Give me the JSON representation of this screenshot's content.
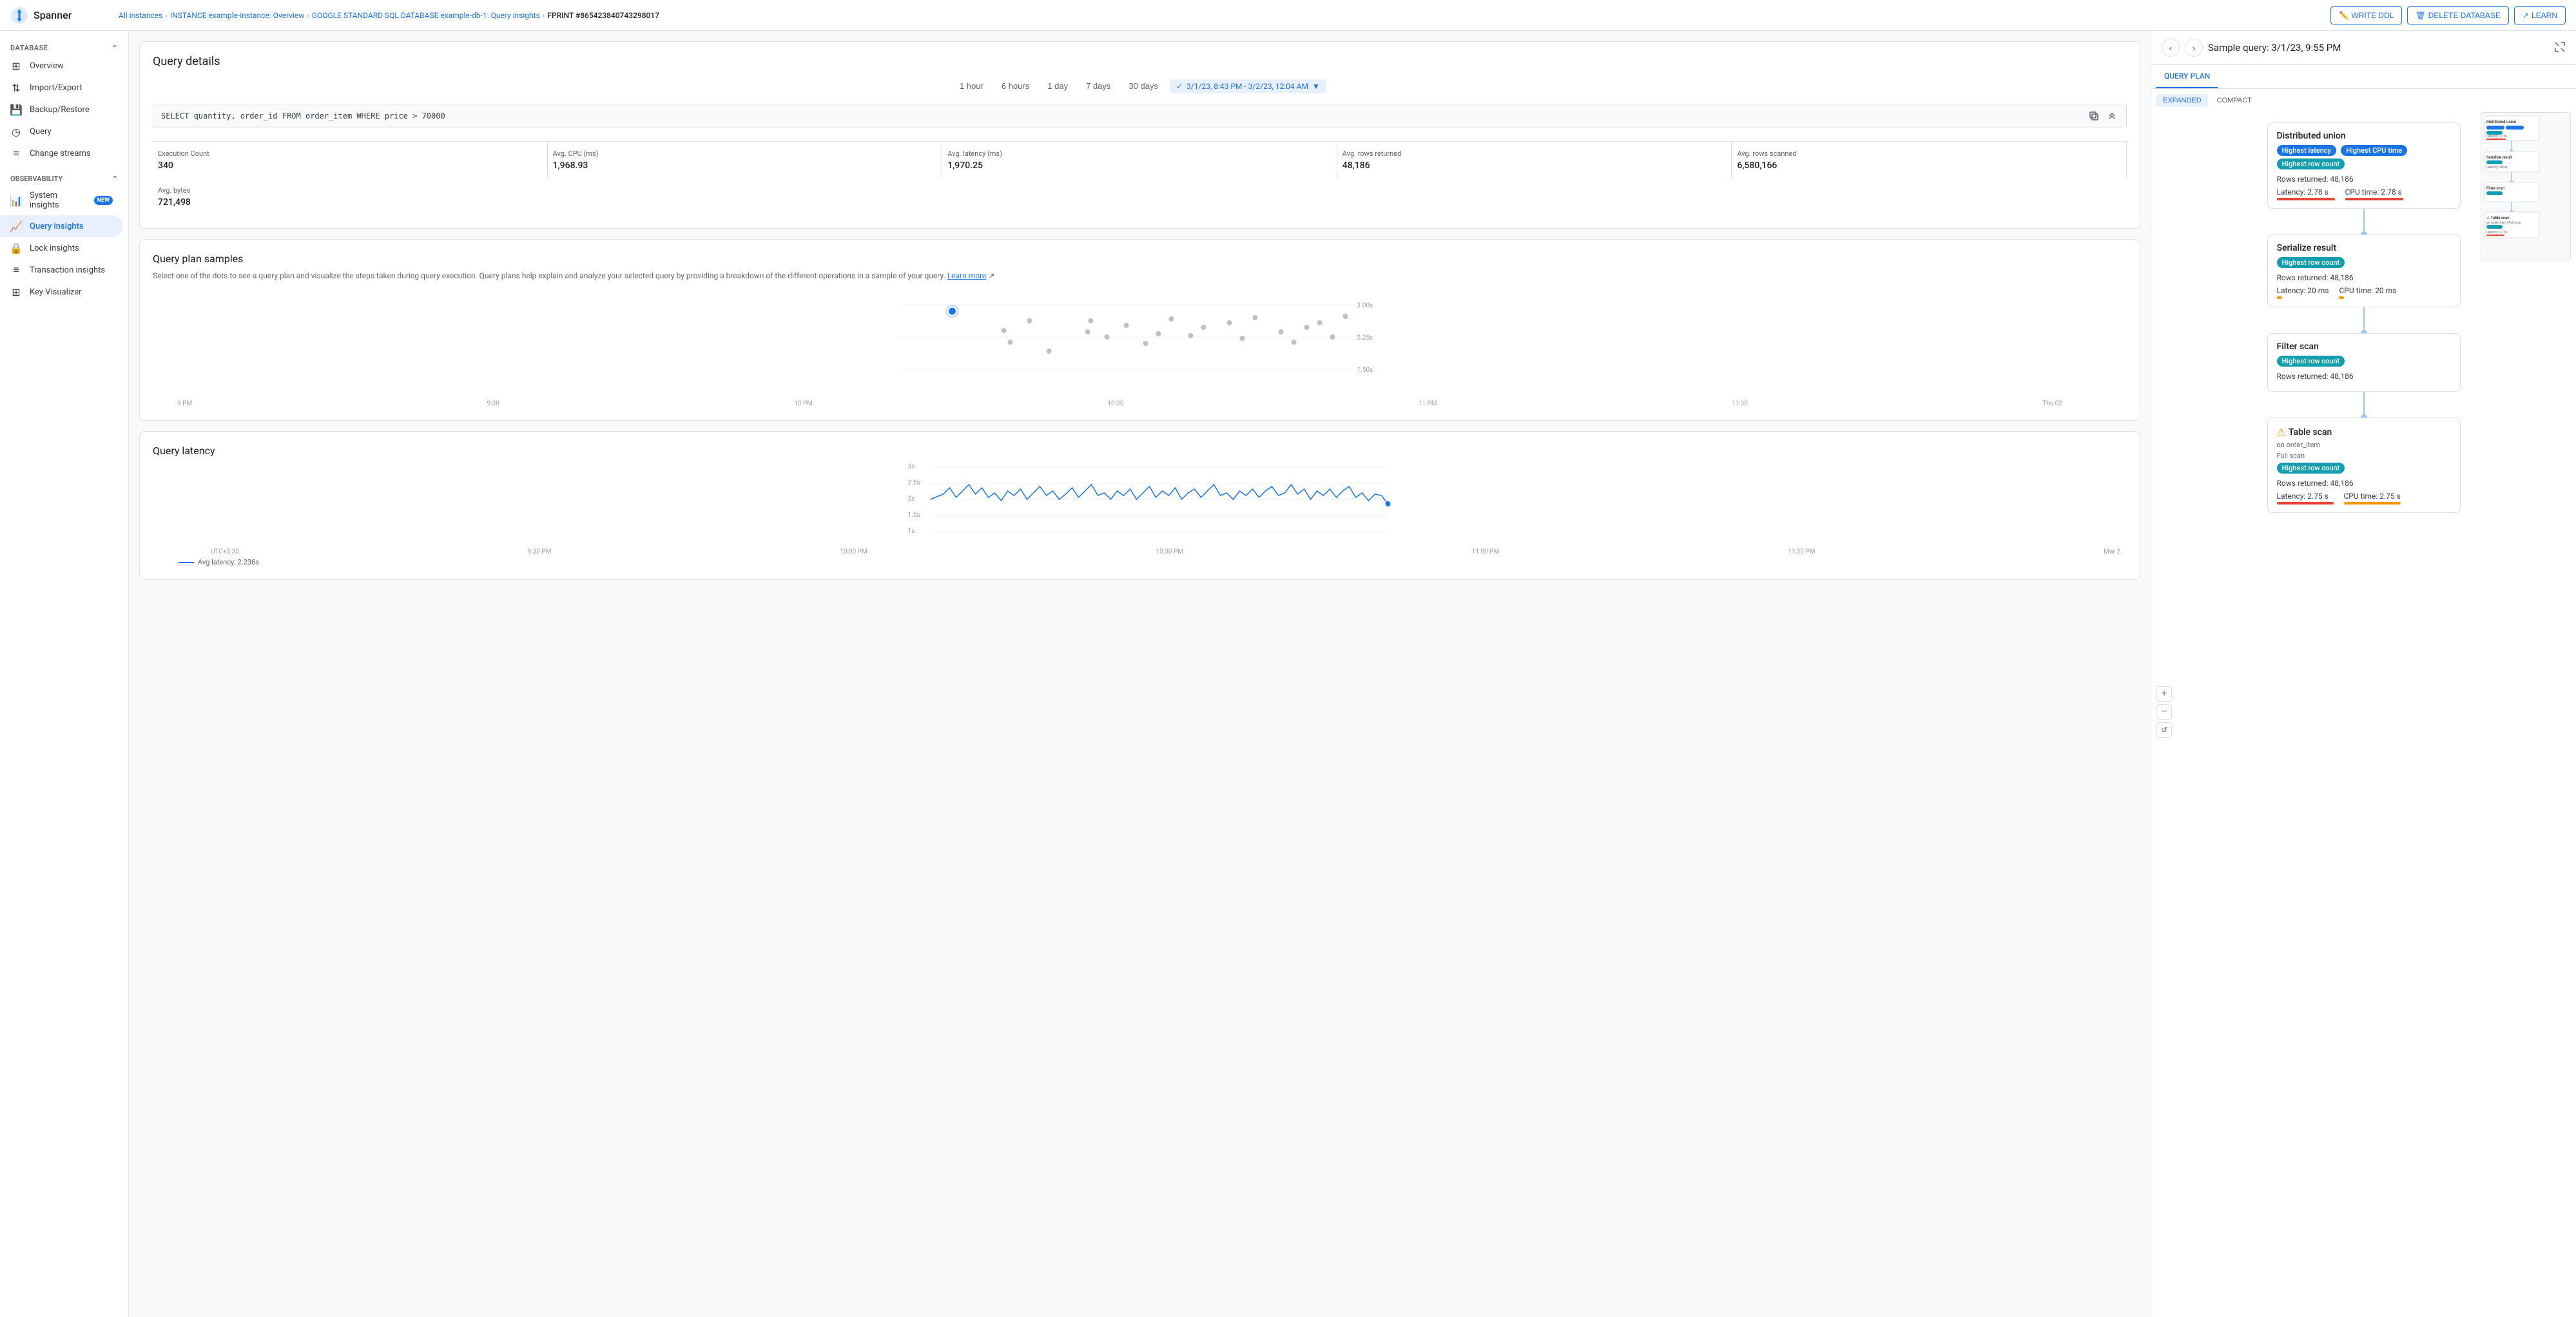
{
  "app": {
    "name": "Spanner"
  },
  "topnav": {
    "breadcrumbs": [
      {
        "label": "All instances",
        "href": "#"
      },
      {
        "label": "INSTANCE example-instance: Overview",
        "href": "#"
      },
      {
        "label": "GOOGLE STANDARD SQL DATABASE example-db-1: Query insights",
        "href": "#"
      },
      {
        "label": "FPRINT #865423840743298017",
        "href": "#",
        "current": true
      }
    ],
    "actions": [
      {
        "label": "WRITE DDL",
        "icon": "✏️"
      },
      {
        "label": "DELETE DATABASE",
        "icon": "🗑"
      },
      {
        "label": "LEARN",
        "icon": "↗"
      }
    ]
  },
  "sidebar": {
    "database_section": "DATABASE",
    "db_items": [
      {
        "id": "overview",
        "label": "Overview",
        "icon": "⊞"
      },
      {
        "id": "import-export",
        "label": "Import/Export",
        "icon": "⇅"
      },
      {
        "id": "backup-restore",
        "label": "Backup/Restore",
        "icon": "💾"
      },
      {
        "id": "query",
        "label": "Query",
        "icon": "◷"
      }
    ],
    "change_streams": {
      "label": "Change streams",
      "icon": "≡"
    },
    "observability_section": "OBSERVABILITY",
    "obs_items": [
      {
        "id": "system-insights",
        "label": "System insights",
        "icon": "📊",
        "badge": "NEW"
      },
      {
        "id": "query-insights",
        "label": "Query insights",
        "icon": "📈",
        "active": true
      },
      {
        "id": "lock-insights",
        "label": "Lock insights",
        "icon": "🔒"
      },
      {
        "id": "transaction-insights",
        "label": "Transaction insights",
        "icon": "≡"
      },
      {
        "id": "key-visualizer",
        "label": "Key Visualizer",
        "icon": "⊞"
      }
    ]
  },
  "query_details": {
    "title": "Query details",
    "time_buttons": [
      "1 hour",
      "6 hours",
      "1 day",
      "7 days",
      "30 days"
    ],
    "selected_range": "3/1/23, 8:43 PM - 3/2/23, 12:04 AM",
    "sql": "SELECT quantity, order_id FROM order_item WHERE price > 70000",
    "stats": [
      {
        "label": "Execution Count",
        "value": "340"
      },
      {
        "label": "Avg. CPU (ms)",
        "value": "1,968.93"
      },
      {
        "label": "Avg. latency (ms)",
        "value": "1,970.25"
      },
      {
        "label": "Avg. rows returned",
        "value": "48,186"
      },
      {
        "label": "Avg. rows scanned",
        "value": "6,580,166"
      },
      {
        "label": "Avg. bytes",
        "value": "721,498"
      }
    ]
  },
  "query_plan_samples": {
    "title": "Query plan samples",
    "description": "Select one of the dots to see a query plan and visualize the steps taken during query execution. Query plans help explain and analyze your selected query by providing a breakdown of the different operations in a sample of your query.",
    "learn_more": "Learn more",
    "x_labels": [
      "9 PM",
      "9:30",
      "10 PM",
      "10:30",
      "11 PM",
      "11:30",
      "Thu 02"
    ],
    "y_labels": [
      "3.00s",
      "2.25s",
      "1.50s"
    ],
    "dots": [
      {
        "x": 15,
        "y": 18,
        "selected": true
      },
      {
        "x": 25,
        "y": 38
      },
      {
        "x": 32,
        "y": 28
      },
      {
        "x": 45,
        "y": 62
      },
      {
        "x": 50,
        "y": 42
      },
      {
        "x": 55,
        "y": 55
      },
      {
        "x": 60,
        "y": 35
      },
      {
        "x": 65,
        "y": 48
      },
      {
        "x": 70,
        "y": 30
      },
      {
        "x": 72,
        "y": 45
      },
      {
        "x": 75,
        "y": 28
      },
      {
        "x": 78,
        "y": 55
      },
      {
        "x": 82,
        "y": 25
      },
      {
        "x": 85,
        "y": 42
      },
      {
        "x": 87,
        "y": 30
      },
      {
        "x": 90,
        "y": 48
      },
      {
        "x": 92,
        "y": 58
      },
      {
        "x": 95,
        "y": 32
      }
    ]
  },
  "query_latency": {
    "title": "Query latency",
    "y_labels": [
      "3s",
      "2.5s",
      "2s",
      "1.5s",
      "1s"
    ],
    "x_labels": [
      "UTC+5:30",
      "9:30 PM",
      "10:00 PM",
      "10:30 PM",
      "11:00 PM",
      "11:30 PM",
      "Mar 2"
    ],
    "legend": "Avg latency: 2.236s"
  },
  "right_panel": {
    "title": "Sample query: 3/1/23, 9:55 PM",
    "tabs": [
      "QUERY PLAN"
    ],
    "view_modes": [
      "EXPANDED",
      "COMPACT"
    ],
    "nodes": [
      {
        "id": "distributed-union",
        "title": "Distributed union",
        "badges": [
          {
            "label": "Highest latency",
            "type": "blue"
          },
          {
            "label": "Highest CPU time",
            "type": "blue"
          },
          {
            "label": "Highest row count",
            "type": "teal"
          }
        ],
        "rows_returned": "Rows returned: 48,186",
        "latency_label": "Latency: 2.78 s",
        "cpu_label": "CPU time: 2.78 s",
        "latency_bar_width": 90,
        "cpu_bar_width": 90,
        "bar_type": "red"
      },
      {
        "id": "serialize-result",
        "title": "Serialize result",
        "badges": [
          {
            "label": "Highest row count",
            "type": "teal"
          }
        ],
        "rows_returned": "Rows returned: 48,186",
        "latency_label": "Latency: 20 ms",
        "cpu_label": "CPU time: 20 ms",
        "latency_bar_width": 8,
        "cpu_bar_width": 8,
        "bar_type": "orange"
      },
      {
        "id": "filter-scan",
        "title": "Filter scan",
        "badges": [
          {
            "label": "Highest row count",
            "type": "teal"
          }
        ],
        "rows_returned": "Rows returned: 48,186",
        "latency_label": "",
        "cpu_label": "",
        "latency_bar_width": 0,
        "cpu_bar_width": 0,
        "bar_type": "orange"
      },
      {
        "id": "table-scan",
        "title": "Table scan",
        "subtitle": "on order_item",
        "subtitle2": "Full scan",
        "badges": [
          {
            "label": "Highest row count",
            "type": "teal"
          }
        ],
        "rows_returned": "Rows returned: 48,186",
        "latency_label": "Latency: 2.75 s",
        "cpu_label": "CPU time: 2.75 s",
        "latency_bar_width": 88,
        "cpu_bar_width": 88,
        "bar_type": "red",
        "warning": true
      }
    ]
  }
}
